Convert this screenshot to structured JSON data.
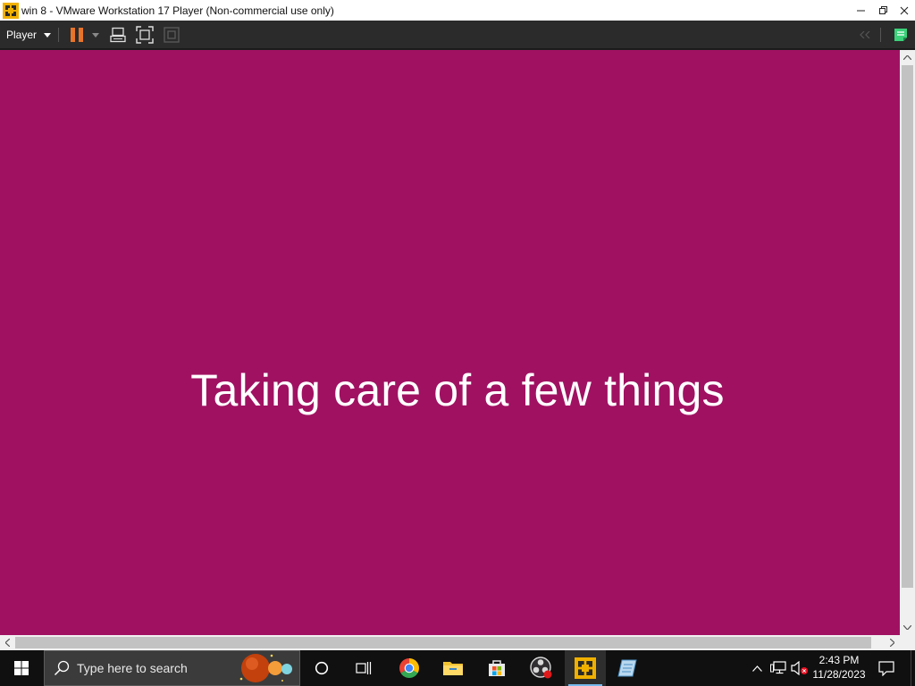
{
  "window": {
    "title": "win 8 - VMware Workstation 17 Player (Non-commercial use only)",
    "icon": "vmware-icon",
    "controls": [
      "minimize-icon",
      "restore-icon",
      "close-icon"
    ]
  },
  "toolbar": {
    "player_menu_label": "Player",
    "items": [
      "pause-icon",
      "dropdown-arrow-icon",
      "send-ctrl-alt-del-icon",
      "fit-guest-icon",
      "unity-icon",
      "collapse-icon",
      "notes-icon"
    ],
    "accent_pause": "#e8742a",
    "accent_notes": "#3bd17a"
  },
  "vm": {
    "background": "#a01162",
    "message": "Taking care of a few things"
  },
  "taskbar": {
    "search_placeholder": "Type here to search",
    "apps": [
      "task-view-icon",
      "chrome-icon",
      "file-explorer-icon",
      "microsoft-store-icon",
      "obs-icon",
      "vmware-icon",
      "notepad-icon"
    ],
    "tray_icons": [
      "show-hidden-icons-icon",
      "network-icon",
      "volume-muted-icon",
      "notifications-icon"
    ],
    "time": "2:43 PM",
    "date": "11/28/2023"
  }
}
